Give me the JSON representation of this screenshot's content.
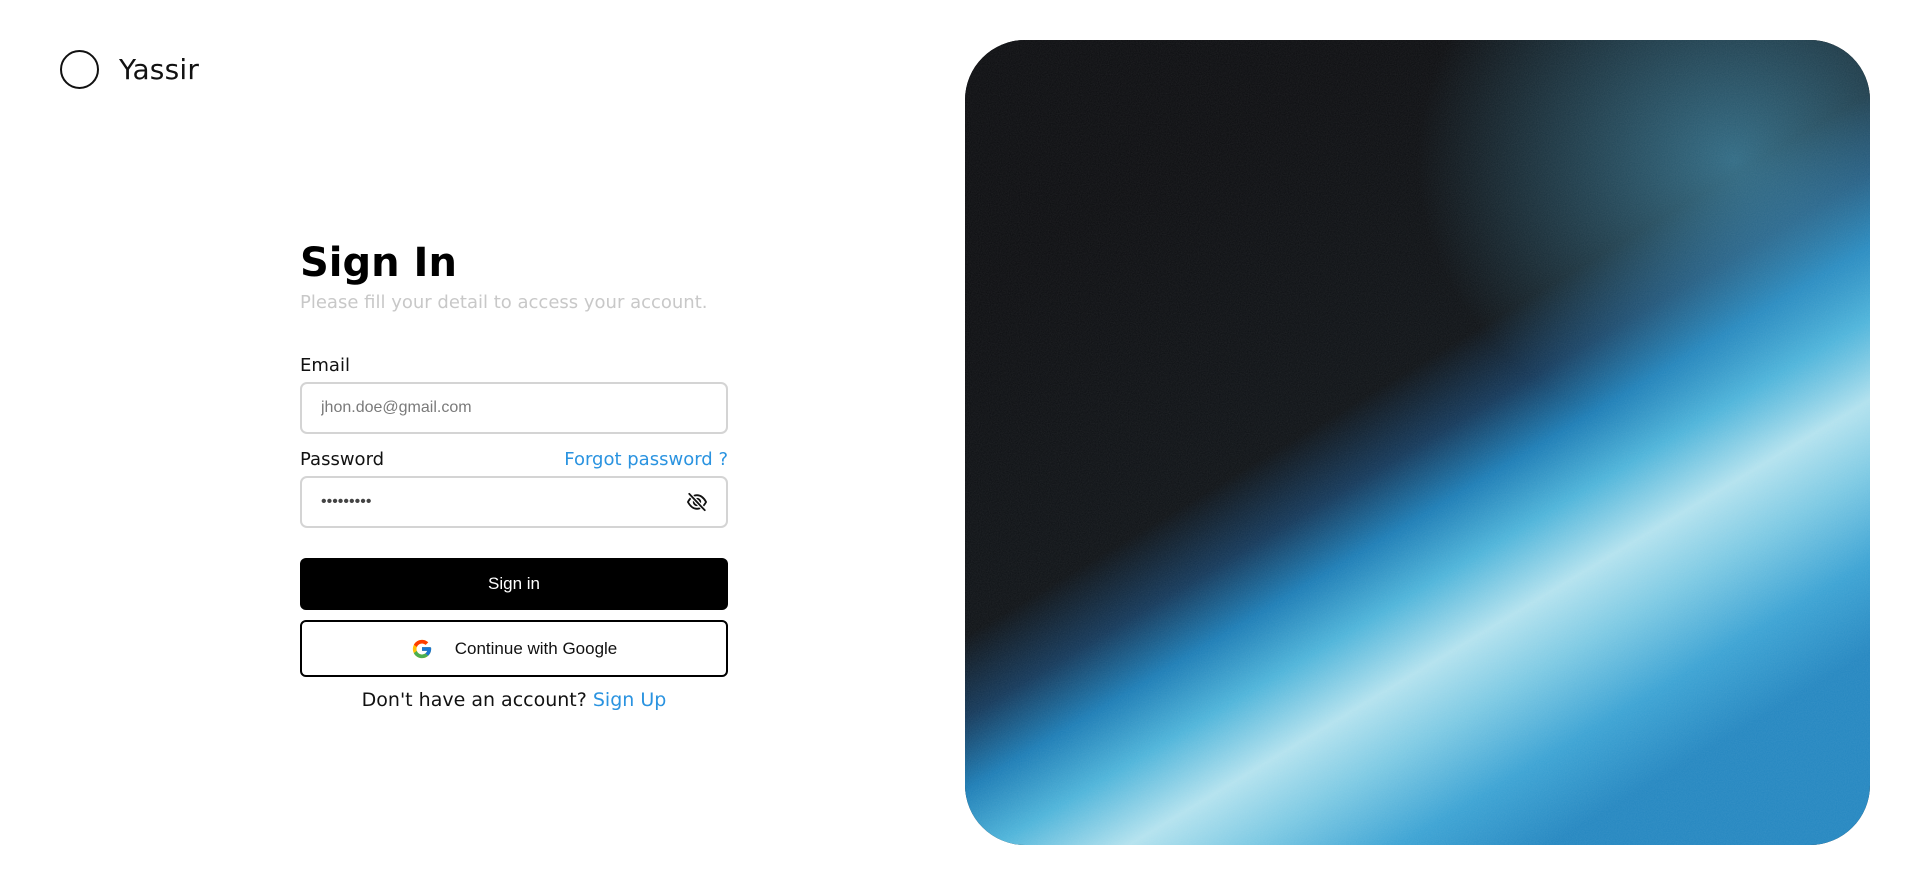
{
  "brand": {
    "name": "Yassir",
    "logo_icon": "circle-logo-icon"
  },
  "form": {
    "title": "Sign In",
    "subtitle": "Please fill your detail to access your account.",
    "email": {
      "label": "Email",
      "value": "",
      "placeholder": "jhon.doe@gmail.com"
    },
    "password": {
      "label": "Password",
      "value": "password1",
      "forgot_link": "Forgot password ?",
      "toggle_icon": "eye-slash-icon"
    },
    "sign_in_label": "Sign in",
    "google_label": "Continue with Google",
    "google_icon": "google-icon",
    "no_account_text": "Don't have an account?",
    "signup_link": "Sign Up"
  },
  "colors": {
    "accent": "#2a93e0",
    "primary_button": "#000000",
    "subtitle": "#c8c8c8",
    "input_border": "#d4d4d4"
  }
}
